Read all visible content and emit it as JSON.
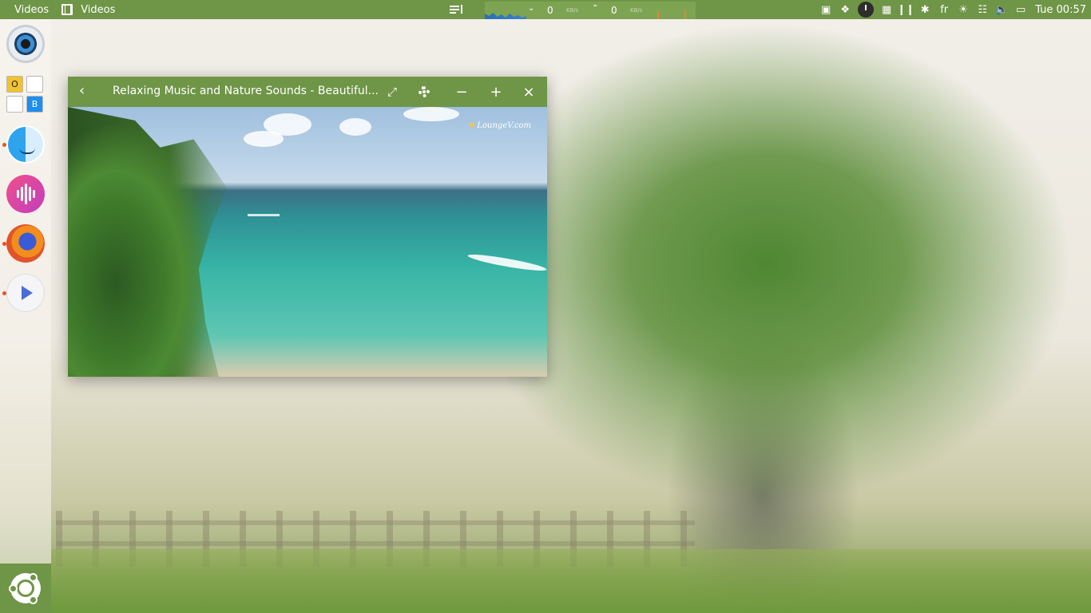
{
  "top_panel": {
    "app_menu": "Videos",
    "window_title": "Videos",
    "net_down_value": "0",
    "net_down_unit": "KB/s",
    "net_up_value": "0",
    "net_up_unit": "KB/s",
    "keyboard_layout": "fr",
    "clock": "Tue 00:57"
  },
  "dock": {
    "ob_cells": [
      "O",
      "",
      "",
      "B"
    ]
  },
  "video_window": {
    "title": "Relaxing Music and Nature Sounds - Beautiful...",
    "watermark": "LoungeV.com"
  }
}
